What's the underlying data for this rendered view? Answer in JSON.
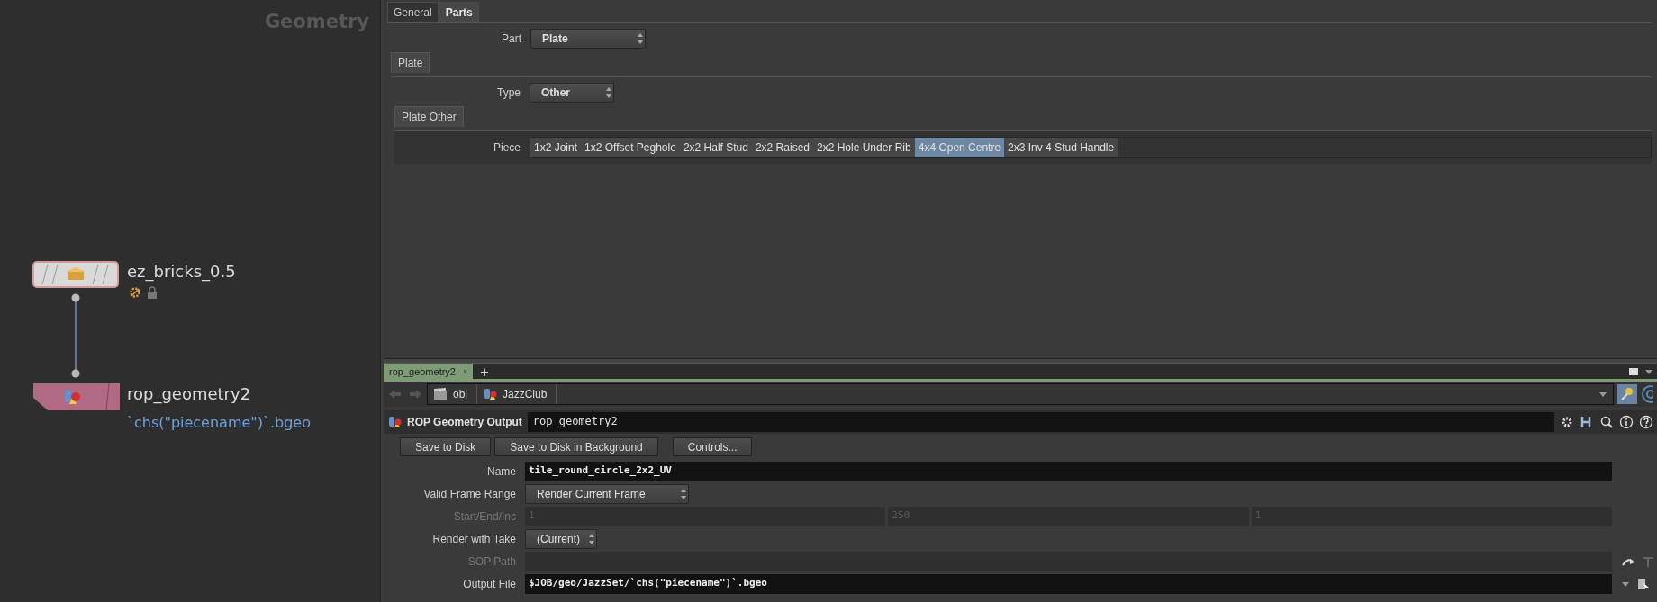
{
  "network": {
    "title": "Geometry",
    "nodes": [
      {
        "kind": "subnet",
        "name": "ez_bricks_0.5"
      },
      {
        "kind": "rop",
        "name": "rop_geometry2",
        "comment": "`chs(\"piecename\")`.bgeo"
      }
    ]
  },
  "parameters": {
    "tabs": [
      {
        "label": "General",
        "selected": false
      },
      {
        "label": "Parts",
        "selected": true
      }
    ],
    "part": {
      "label": "Part",
      "value": "Plate"
    },
    "folder": "Plate",
    "type": {
      "label": "Type",
      "value": "Other"
    },
    "subfolder": "Plate Other",
    "piece": {
      "label": "Piece",
      "options": [
        {
          "label": "1x2 Joint",
          "selected": false
        },
        {
          "label": "1x2 Offset Peghole",
          "selected": false
        },
        {
          "label": "2x2 Half Stud",
          "selected": false
        },
        {
          "label": "2x2 Raised",
          "selected": false
        },
        {
          "label": "2x2 Hole Under Rib",
          "selected": false
        },
        {
          "label": "4x4 Open Centre",
          "selected": true
        },
        {
          "label": "2x3 Inv 4 Stud Handle",
          "selected": false
        }
      ]
    }
  },
  "pane_tabs": [
    {
      "label": "rop_geometry2",
      "close": "×",
      "selected": true
    }
  ],
  "add_tab": "+",
  "path": [
    "obj",
    "JazzClub"
  ],
  "node_header": {
    "type": "ROP Geometry Output",
    "name": "rop_geometry2"
  },
  "buttons": [
    "Save to Disk",
    "Save to Disk in Background",
    "Controls..."
  ],
  "rows": [
    {
      "kind": "text",
      "label": "Name",
      "value": "tile_round_circle_2x2_UV",
      "disabled": false
    },
    {
      "kind": "menu",
      "label": "Valid Frame Range",
      "value": "Render Current Frame",
      "disabled": false
    },
    {
      "kind": "triple",
      "label": "Start/End/Inc",
      "values": [
        "1",
        "250",
        "1"
      ],
      "disabled": true
    },
    {
      "kind": "menu",
      "label": "Render with Take",
      "value": "(Current)",
      "disabled": false
    },
    {
      "kind": "path",
      "label": "SOP Path",
      "disabled": true
    },
    {
      "kind": "file",
      "label": "Output File",
      "value": "$JOB/geo/JazzSet/`chs(\"piecename\")`.bgeo",
      "disabled": false
    }
  ]
}
